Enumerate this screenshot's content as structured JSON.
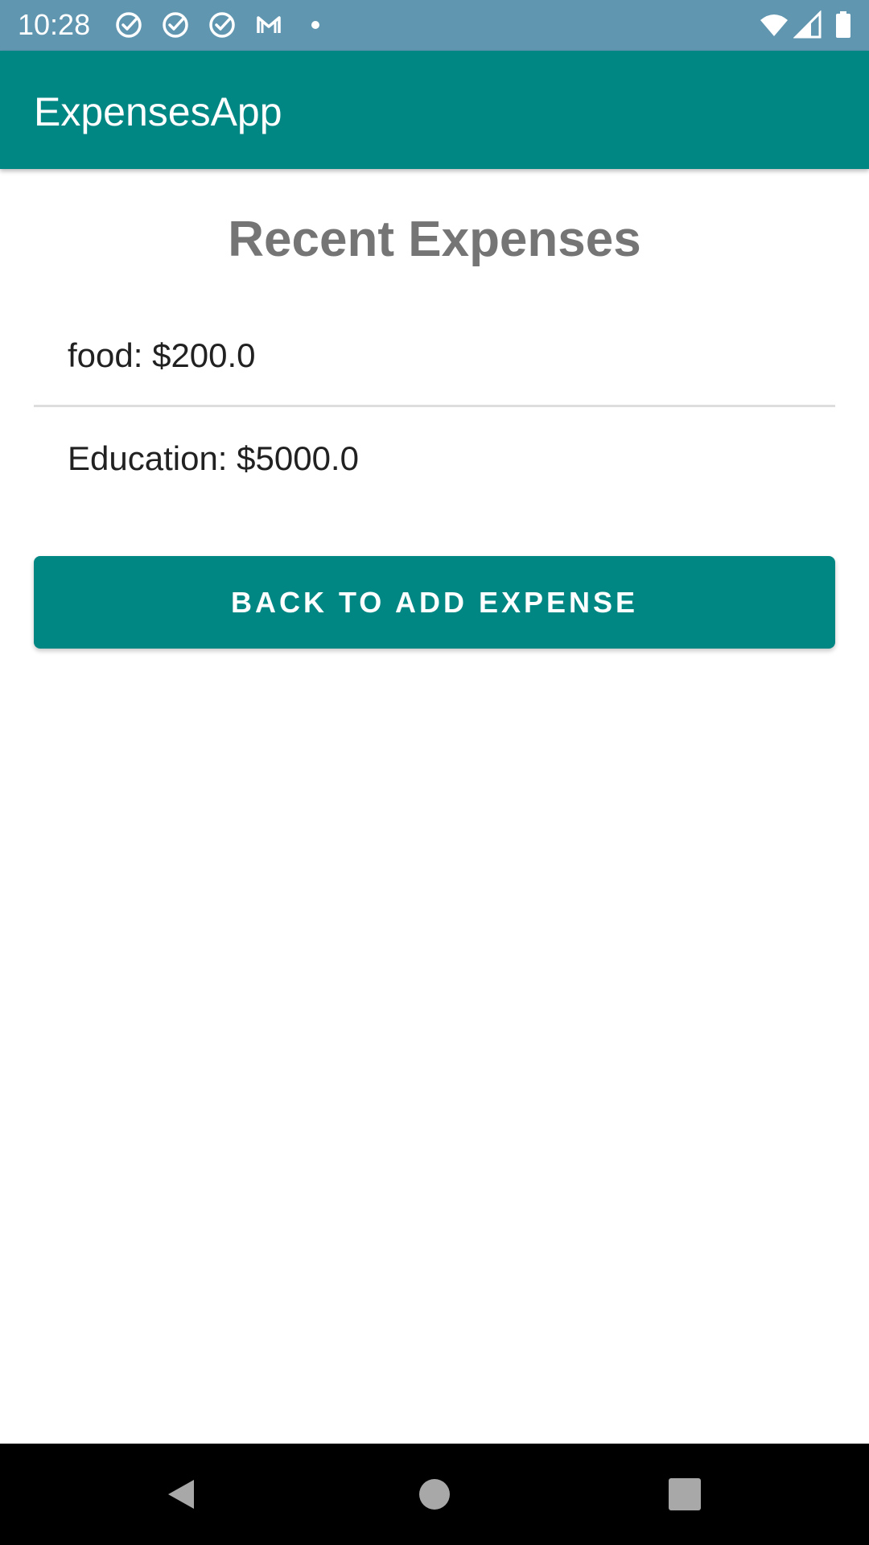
{
  "status_bar": {
    "time": "10:28",
    "background_color": "#6096b0",
    "icons": [
      "check-circle-icon",
      "check-circle-icon",
      "check-circle-icon",
      "gmail-icon",
      "notification-dot-icon",
      "wifi-icon",
      "cellular-signal-icon",
      "battery-icon"
    ]
  },
  "app_bar": {
    "title": "ExpensesApp",
    "color": "#008784"
  },
  "main": {
    "heading": "Recent Expenses",
    "expenses": [
      {
        "label": "food: $200.0"
      },
      {
        "label": "Education: $5000.0"
      }
    ],
    "back_button_label": "BACK TO ADD EXPENSE"
  },
  "nav_bar": {
    "icons": [
      "back-icon",
      "home-icon",
      "recents-icon"
    ]
  }
}
